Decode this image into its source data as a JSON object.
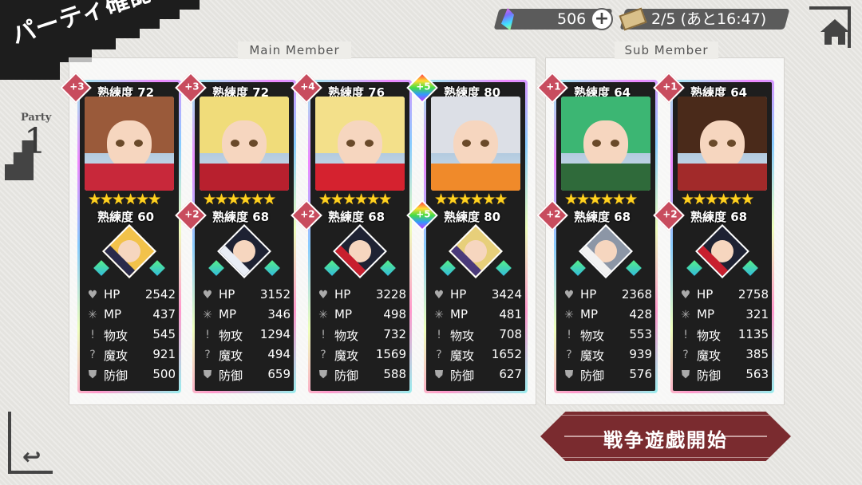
{
  "screen_title": "パーティ確認",
  "hud": {
    "gems": "506",
    "plus": "+",
    "stamina": "2/5 (あと16:47)"
  },
  "party": {
    "label": "Party",
    "number": "1"
  },
  "labels": {
    "main_member": "Main Member",
    "sub_member": "Sub Member",
    "start_battle": "戦争遊戯開始"
  },
  "stat_labels": {
    "hp": "HP",
    "mp": "MP",
    "atk": "物攻",
    "matk": "魔攻",
    "def": "防御"
  },
  "cards": [
    {
      "plus": "+3",
      "rainbow": false,
      "proficiency": "熟練度 72",
      "stars": "★★★★★★",
      "sub_plus": "",
      "sub_rainbow": false,
      "sub_proficiency": "熟練度 60",
      "hair": "#9a5a3a",
      "outfit": "#c8283a",
      "sub_hair": "#f2c24a",
      "sub_outfit": "#2a2a4a",
      "hp": "2542",
      "mp": "437",
      "atk": "545",
      "matk": "921",
      "def": "500"
    },
    {
      "plus": "+3",
      "rainbow": false,
      "proficiency": "熟練度 72",
      "stars": "★★★★★★",
      "sub_plus": "+2",
      "sub_rainbow": false,
      "sub_proficiency": "熟練度 68",
      "hair": "#f0dc7a",
      "outfit": "#b8202e",
      "sub_hair": "#1e2233",
      "sub_outfit": "#e9edf5",
      "hp": "3152",
      "mp": "346",
      "atk": "1294",
      "matk": "494",
      "def": "659"
    },
    {
      "plus": "+4",
      "rainbow": false,
      "proficiency": "熟練度 76",
      "stars": "★★★★★★",
      "sub_plus": "+2",
      "sub_rainbow": false,
      "sub_proficiency": "熟練度 68",
      "hair": "#f3e08a",
      "outfit": "#d5222f",
      "sub_hair": "#1e2233",
      "sub_outfit": "#c81f2e",
      "hp": "3228",
      "mp": "498",
      "atk": "732",
      "matk": "1569",
      "def": "588"
    },
    {
      "plus": "+5",
      "rainbow": true,
      "proficiency": "熟練度 80",
      "stars": "★★★★★★",
      "sub_plus": "+5",
      "sub_rainbow": true,
      "sub_proficiency": "熟練度 80",
      "hair": "#dcdfe6",
      "outfit": "#f08a2a",
      "sub_hair": "#e7cf7a",
      "sub_outfit": "#4a3a7a",
      "hp": "3424",
      "mp": "481",
      "atk": "708",
      "matk": "1652",
      "def": "627"
    },
    {
      "plus": "+1",
      "rainbow": false,
      "proficiency": "熟練度 64",
      "stars": "★★★★★★",
      "sub_plus": "+2",
      "sub_rainbow": false,
      "sub_proficiency": "熟練度 68",
      "hair": "#3cb673",
      "outfit": "#2f6a3a",
      "sub_hair": "#8c96a6",
      "sub_outfit": "#f2f2f2",
      "hp": "2368",
      "mp": "428",
      "atk": "553",
      "matk": "939",
      "def": "576"
    },
    {
      "plus": "+1",
      "rainbow": false,
      "proficiency": "熟練度 64",
      "stars": "★★★★★★",
      "sub_plus": "+2",
      "sub_rainbow": false,
      "sub_proficiency": "熟練度 68",
      "hair": "#4a2a1a",
      "outfit": "#a22a2a",
      "sub_hair": "#1e2233",
      "sub_outfit": "#c81f2e",
      "hp": "2758",
      "mp": "321",
      "atk": "1135",
      "matk": "385",
      "def": "563"
    }
  ],
  "icons": {
    "gem": "gem-icon",
    "ticket": "ticket-icon",
    "home": "home-icon",
    "back": "back-arrow-icon",
    "hp": "heart-icon",
    "mp": "mp-icon",
    "atk": "sword-icon",
    "matk": "magic-icon",
    "def": "shield-icon"
  }
}
